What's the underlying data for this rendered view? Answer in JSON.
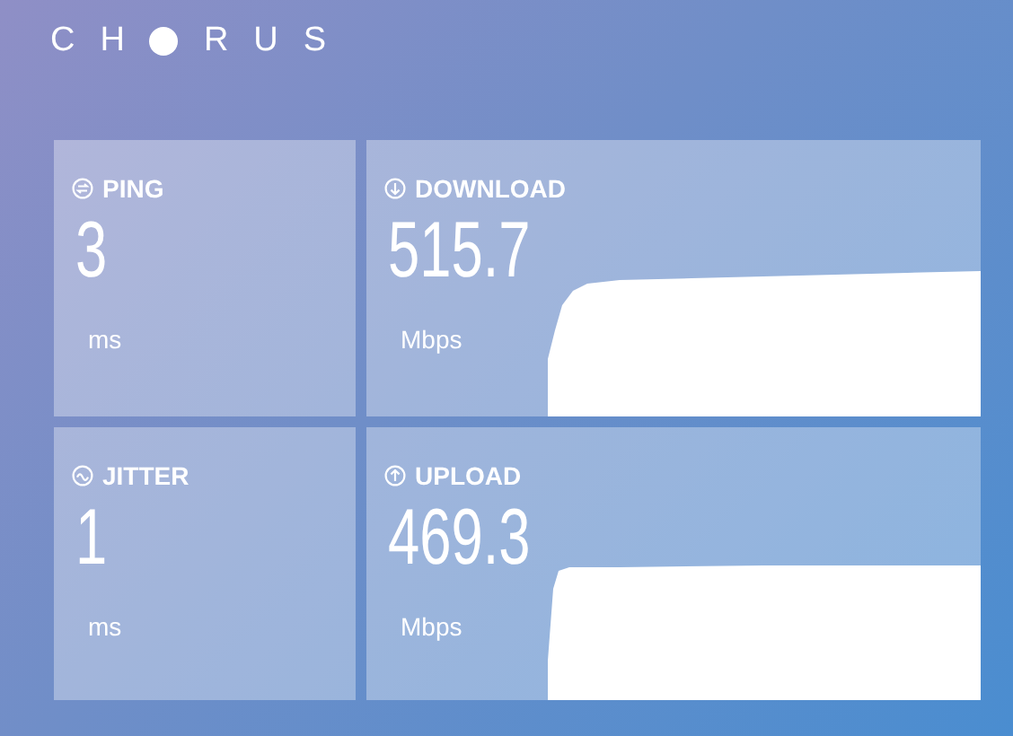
{
  "logo": {
    "before": "CH",
    "after": "RUS"
  },
  "cards": [
    {
      "kind": "ping",
      "label": "PING",
      "value": "3",
      "unit": "ms"
    },
    {
      "kind": "download",
      "label": "DOWNLOAD",
      "value": "515.7",
      "unit": "Mbps"
    },
    {
      "kind": "jitter",
      "label": "JITTER",
      "value": "1",
      "unit": "ms"
    },
    {
      "kind": "upload",
      "label": "UPLOAD",
      "value": "469.3",
      "unit": "Mbps"
    }
  ]
}
